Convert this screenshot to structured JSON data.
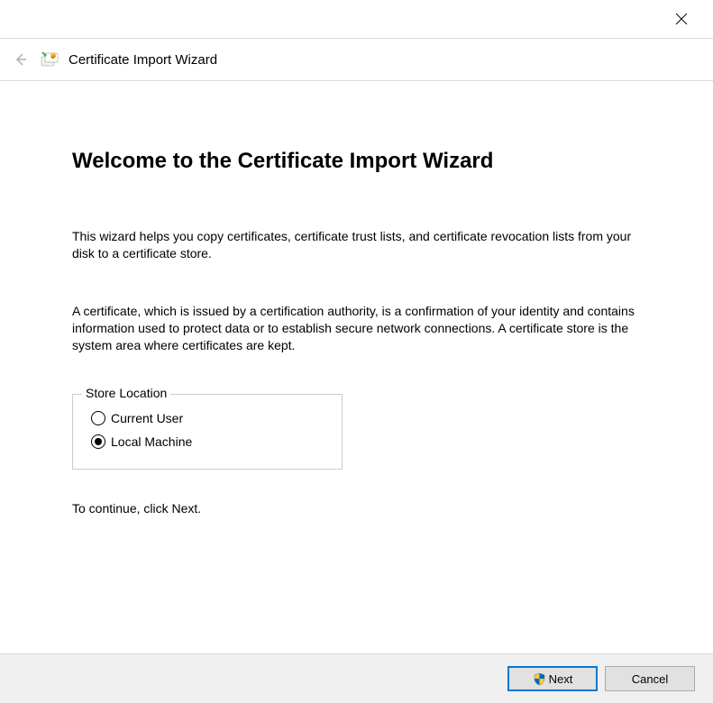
{
  "header": {
    "title": "Certificate Import Wizard"
  },
  "main": {
    "heading": "Welcome to the Certificate Import Wizard",
    "paragraph1": "This wizard helps you copy certificates, certificate trust lists, and certificate revocation lists from your disk to a certificate store.",
    "paragraph2": "A certificate, which is issued by a certification authority, is a confirmation of your identity and contains information used to protect data or to establish secure network connections. A certificate store is the system area where certificates are kept.",
    "storeLocation": {
      "legend": "Store Location",
      "option1": "Current User",
      "option2": "Local Machine"
    },
    "continueText": "To continue, click Next."
  },
  "footer": {
    "nextLabel": "Next",
    "cancelLabel": "Cancel"
  }
}
